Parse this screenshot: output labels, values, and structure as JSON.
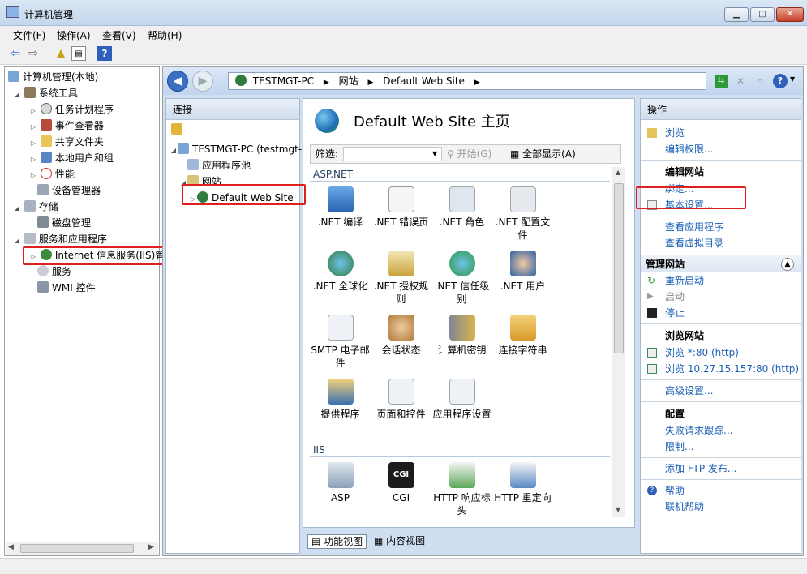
{
  "window": {
    "title": "计算机管理",
    "buttons": {
      "minimize": "▁",
      "maximize": "□",
      "close": "✕"
    }
  },
  "menu": [
    "文件(F)",
    "操作(A)",
    "查看(V)",
    "帮助(H)"
  ],
  "tree": {
    "root": "计算机管理(本地)",
    "items": [
      {
        "label": "系统工具",
        "level": 1
      },
      {
        "label": "任务计划程序",
        "level": 2
      },
      {
        "label": "事件查看器",
        "level": 2
      },
      {
        "label": "共享文件夹",
        "level": 2
      },
      {
        "label": "本地用户和组",
        "level": 2
      },
      {
        "label": "性能",
        "level": 2
      },
      {
        "label": "设备管理器",
        "level": 2
      },
      {
        "label": "存储",
        "level": 1
      },
      {
        "label": "磁盘管理",
        "level": 2
      },
      {
        "label": "服务和应用程序",
        "level": 1
      },
      {
        "label": "Internet 信息服务(IIS)管",
        "level": 2
      },
      {
        "label": "服务",
        "level": 2
      },
      {
        "label": "WMI 控件",
        "level": 2
      }
    ]
  },
  "iis": {
    "breadcrumb": [
      "TESTMGT-PC",
      "网站",
      "Default Web Site"
    ],
    "connections": {
      "header": "连接",
      "server": "TESTMGT-PC (testmgt-P",
      "apppools": "应用程序池",
      "sites": "网站",
      "site": "Default Web Site"
    },
    "center": {
      "title": "Default Web Site 主页",
      "filter_label": "筛选:",
      "start_label": "开始(G)",
      "showall_label": "全部显示(A)",
      "groups": [
        {
          "name": "ASP.NET",
          "features": [
            ".NET 编译",
            ".NET 错误页",
            ".NET 角色",
            ".NET 配置文件",
            ".NET 全球化",
            ".NET 授权规则",
            ".NET 信任级别",
            ".NET 用户",
            "SMTP 电子邮件",
            "会话状态",
            "计算机密钥",
            "连接字符串",
            "提供程序",
            "页面和控件",
            "应用程序设置"
          ]
        },
        {
          "name": "IIS",
          "features": [
            "ASP",
            "CGI",
            "HTTP 响应标头",
            "HTTP 重定向"
          ]
        }
      ],
      "tabs": {
        "features": "功能视图",
        "content": "内容视图"
      }
    },
    "actions": {
      "header": "操作",
      "browse": "浏览",
      "edit_perms": "编辑权限...",
      "edit_site": "编辑网站",
      "bindings": "绑定...",
      "basic_settings": "基本设置...",
      "view_apps": "查看应用程序",
      "view_vdirs": "查看虚拟目录",
      "manage_site": "管理网站",
      "restart": "重新启动",
      "start": "启动",
      "stop": "停止",
      "browse_site": "浏览网站",
      "browse_80": "浏览 *:80 (http)",
      "browse_ip": "浏览 10.27.15.157:80 (http)",
      "advanced": "高级设置...",
      "config": "配置",
      "failed_req": "失败请求跟踪...",
      "limits": "限制...",
      "add_ftp": "添加 FTP 发布...",
      "help": "帮助",
      "online_help": "联机帮助"
    }
  },
  "colors": {
    "highlight": "#e02020",
    "link": "#1a5fb4",
    "nav_blue": "#3a6fc4"
  }
}
